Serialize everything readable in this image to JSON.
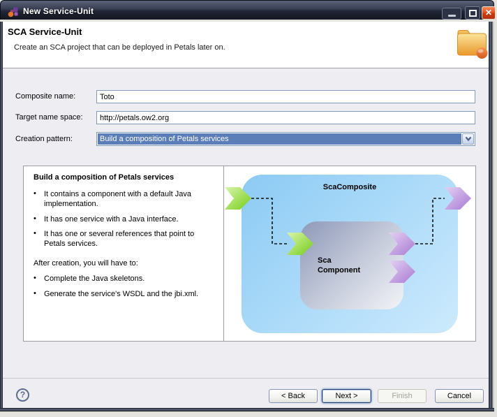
{
  "window": {
    "title": "New Service-Unit",
    "close_glyph": "✕"
  },
  "header": {
    "title": "SCA Service-Unit",
    "description": "Create an SCA project that can be deployed in Petals later on."
  },
  "form": {
    "fields": [
      {
        "label": "Composite name:",
        "value": "Toto"
      },
      {
        "label": "Target name space:",
        "value": "http://petals.ow2.org"
      },
      {
        "label": "Creation pattern:",
        "value": "Build a composition of Petals services"
      }
    ]
  },
  "description_panel": {
    "title": "Build a composition of Petals services",
    "bullet_glyph": "•",
    "bullets": [
      "It contains a component with a default Java implementation.",
      "It has one service with a Java interface.",
      "It has one or several references that point to Petals services."
    ],
    "after_title": "After creation, you will have to:",
    "after_bullets": [
      "Complete the Java skeletons.",
      "Generate the service's WSDL and the jbi.xml."
    ]
  },
  "diagram": {
    "composite_label": "ScaComposite",
    "component_label_line1": "Sca",
    "component_label_line2": "Component"
  },
  "footer": {
    "help_glyph": "?",
    "buttons": [
      {
        "label": "< Back"
      },
      {
        "label": "Next >"
      },
      {
        "label": "Finish"
      },
      {
        "label": "Cancel"
      }
    ]
  },
  "colors": {
    "titlebar_dark": "#14171f",
    "selection_blue": "#5b7db8",
    "arrow_green": "#84d22b",
    "arrow_purple": "#b388d8",
    "composite_blue": "#8ccaf4",
    "folder_orange": "#eda437"
  }
}
